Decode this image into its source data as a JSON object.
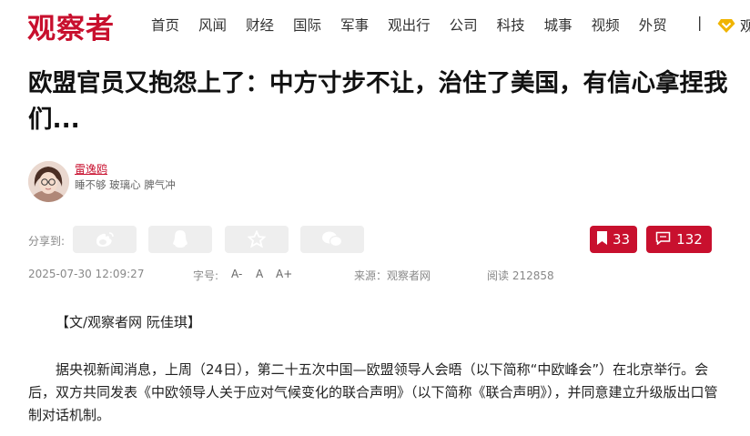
{
  "header": {
    "logo": "观察者",
    "nav": [
      "首页",
      "风闻",
      "财经",
      "国际",
      "军事",
      "观出行",
      "公司",
      "科技",
      "城事",
      "视频",
      "外贸"
    ],
    "separator": "|",
    "vip_label": "观"
  },
  "article": {
    "title": "欧盟官员又抱怨上了：中方寸步不让，治住了美国，有信心拿捏我们...",
    "author": {
      "name": "雷逸鸥",
      "bio": "睡不够 玻璃心 脾气冲"
    },
    "share_label": "分享到:",
    "collect_count": "33",
    "comment_count": "132",
    "date": "2025-07-30 12:09:27",
    "font_label": "字号:",
    "font_small": "A-",
    "font_normal": "A",
    "font_large": "A+",
    "source": "来源：观察者网",
    "reads": "阅读 212858",
    "byline": "【文/观察者网 阮佳琪】",
    "paragraph1": "据央视新闻消息，上周（24日），第二十五次中国—欧盟领导人会晤（以下简称“中欧峰会”）在北京举行。会后，双方共同发表《中欧领导人关于应对气候变化的联合声明》（以下简称《联合声明》），并同意建立升级版出口管制对话机制。"
  },
  "colors": {
    "brand": "#c8102e",
    "share_bg": "#eeeeee",
    "vip_gold": "#f0b400"
  }
}
